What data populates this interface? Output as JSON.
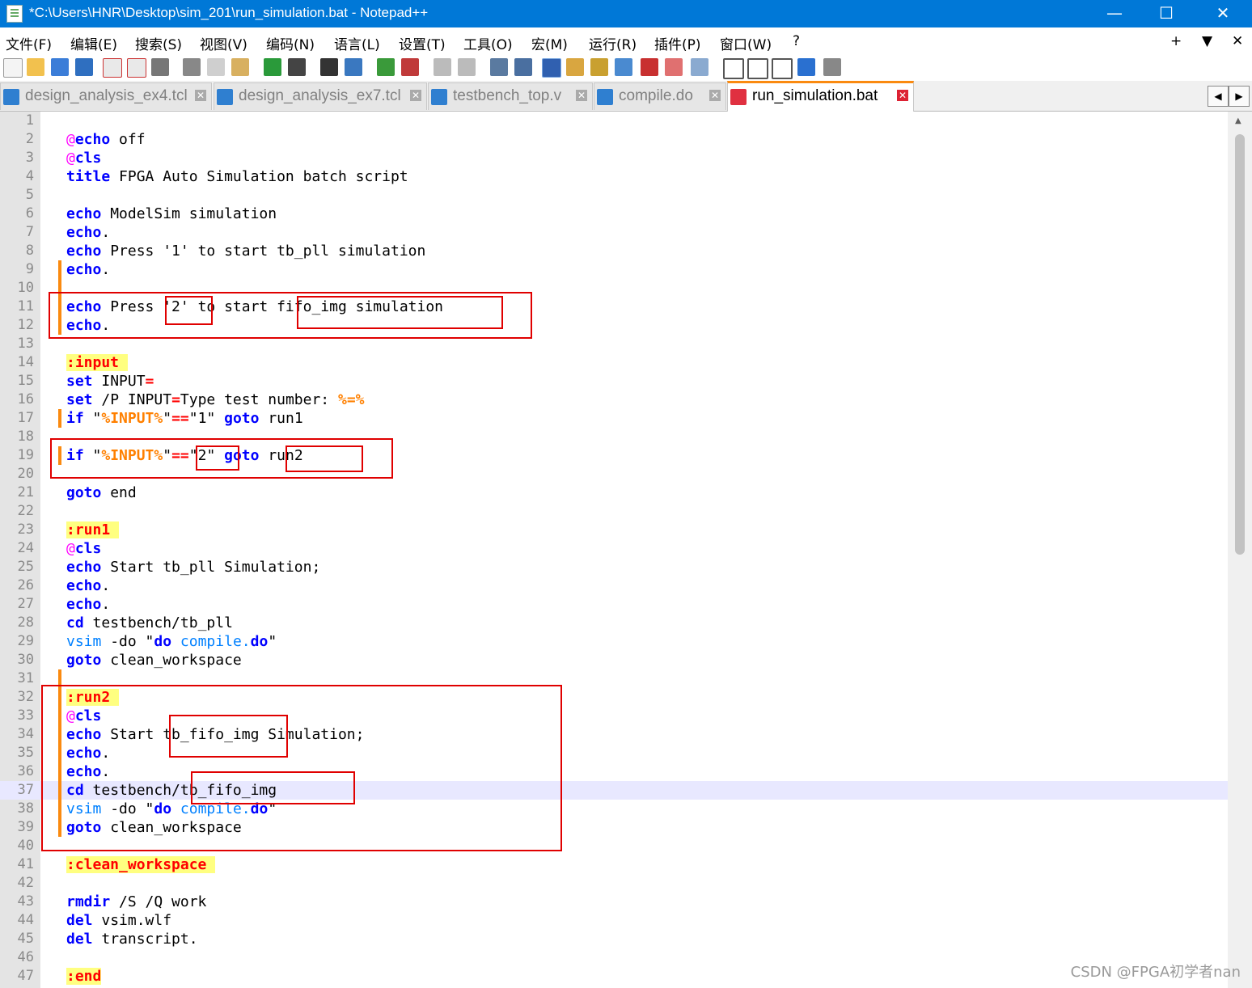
{
  "window": {
    "title": "*C:\\Users\\HNR\\Desktop\\sim_201\\run_simulation.bat - Notepad++",
    "minimize": "—",
    "maximize": "☐",
    "close": "✕"
  },
  "menu": {
    "items": [
      "文件(F)",
      "编辑(E)",
      "搜索(S)",
      "视图(V)",
      "编码(N)",
      "语言(L)",
      "设置(T)",
      "工具(O)",
      "宏(M)",
      "运行(R)",
      "插件(P)",
      "窗口(W)",
      "?"
    ],
    "right_plus": "+",
    "right_down": "▼",
    "right_close": "✕"
  },
  "tabs": [
    {
      "label": "design_analysis_ex4.tcl",
      "active": false
    },
    {
      "label": "design_analysis_ex7.tcl",
      "active": false
    },
    {
      "label": "testbench_top.v",
      "active": false
    },
    {
      "label": "compile.do",
      "active": false
    },
    {
      "label": "run_simulation.bat",
      "active": true
    }
  ],
  "tab_nav": {
    "left": "◀",
    "right": "▶"
  },
  "line_numbers": [
    "1",
    "2",
    "3",
    "4",
    "5",
    "6",
    "7",
    "8",
    "9",
    "10",
    "11",
    "12",
    "13",
    "14",
    "15",
    "16",
    "17",
    "18",
    "19",
    "20",
    "21",
    "22",
    "23",
    "24",
    "25",
    "26",
    "27",
    "28",
    "29",
    "30",
    "31",
    "32",
    "33",
    "34",
    "35",
    "36",
    "37",
    "38",
    "39",
    "40",
    "41",
    "42",
    "43",
    "44",
    "45",
    "46",
    "47"
  ],
  "code_lines": [
    [],
    [
      [
        "at",
        "@"
      ],
      [
        "kw",
        "echo"
      ],
      [
        "t",
        " off"
      ]
    ],
    [
      [
        "at",
        "@"
      ],
      [
        "kw",
        "cls"
      ]
    ],
    [
      [
        "kw",
        "title"
      ],
      [
        "t",
        " FPGA Auto Simulation batch script"
      ]
    ],
    [],
    [
      [
        "kw",
        "echo"
      ],
      [
        "t",
        " ModelSim simulation"
      ]
    ],
    [
      [
        "kw",
        "echo"
      ],
      [
        "t",
        "."
      ]
    ],
    [
      [
        "kw",
        "echo"
      ],
      [
        "t",
        " Press '1' to start tb_pll simulation"
      ]
    ],
    [
      [
        "kw",
        "echo"
      ],
      [
        "t",
        "."
      ]
    ],
    [],
    [
      [
        "kw",
        "echo"
      ],
      [
        "t",
        " Press '2' to start fifo_img simulation"
      ]
    ],
    [
      [
        "kw",
        "echo"
      ],
      [
        "t",
        "."
      ]
    ],
    [],
    [
      [
        "lbl",
        ":input "
      ]
    ],
    [
      [
        "kw",
        "set"
      ],
      [
        "t",
        " INPUT"
      ],
      [
        "op",
        "="
      ]
    ],
    [
      [
        "kw",
        "set"
      ],
      [
        "t",
        " /P INPUT"
      ],
      [
        "op",
        "="
      ],
      [
        "t",
        "Type test number: "
      ],
      [
        "var",
        "%=%"
      ]
    ],
    [
      [
        "kw",
        "if"
      ],
      [
        "t",
        " \""
      ],
      [
        "var",
        "%INPUT%"
      ],
      [
        "t",
        "\""
      ],
      [
        "op",
        "=="
      ],
      [
        "t",
        "\"1\" "
      ],
      [
        "kw",
        "goto"
      ],
      [
        "t",
        " run1"
      ]
    ],
    [],
    [
      [
        "kw",
        "if"
      ],
      [
        "t",
        " \""
      ],
      [
        "var",
        "%INPUT%"
      ],
      [
        "t",
        "\""
      ],
      [
        "op",
        "=="
      ],
      [
        "t",
        "\"2\" "
      ],
      [
        "kw",
        "goto"
      ],
      [
        "t",
        " run2"
      ]
    ],
    [],
    [
      [
        "kw",
        "goto"
      ],
      [
        "t",
        " end"
      ]
    ],
    [],
    [
      [
        "lbl",
        ":run1 "
      ]
    ],
    [
      [
        "at",
        "@"
      ],
      [
        "kw",
        "cls"
      ]
    ],
    [
      [
        "kw",
        "echo"
      ],
      [
        "t",
        " Start tb_pll Simulation;"
      ]
    ],
    [
      [
        "kw",
        "echo"
      ],
      [
        "t",
        "."
      ]
    ],
    [
      [
        "kw",
        "echo"
      ],
      [
        "t",
        "."
      ]
    ],
    [
      [
        "kw",
        "cd"
      ],
      [
        "t",
        " testbench/tb_pll"
      ]
    ],
    [
      [
        "ext",
        "vsim"
      ],
      [
        "t",
        " -do \""
      ],
      [
        "kw",
        "do"
      ],
      [
        "t",
        " "
      ],
      [
        "ext",
        "compile."
      ],
      [
        "kw",
        "do"
      ],
      [
        "t",
        "\""
      ]
    ],
    [
      [
        "kw",
        "goto"
      ],
      [
        "t",
        " clean_workspace"
      ]
    ],
    [],
    [
      [
        "lbl",
        ":run2 "
      ]
    ],
    [
      [
        "at",
        "@"
      ],
      [
        "kw",
        "cls"
      ]
    ],
    [
      [
        "kw",
        "echo"
      ],
      [
        "t",
        " Start tb_fifo_img Simulation;"
      ]
    ],
    [
      [
        "kw",
        "echo"
      ],
      [
        "t",
        "."
      ]
    ],
    [
      [
        "kw",
        "echo"
      ],
      [
        "t",
        "."
      ]
    ],
    [
      [
        "kw",
        "cd"
      ],
      [
        "t",
        " testbench/tb_fifo_img"
      ]
    ],
    [
      [
        "ext",
        "vsim"
      ],
      [
        "t",
        " -do \""
      ],
      [
        "kw",
        "do"
      ],
      [
        "t",
        " "
      ],
      [
        "ext",
        "compile."
      ],
      [
        "kw",
        "do"
      ],
      [
        "t",
        "\""
      ]
    ],
    [
      [
        "kw",
        "goto"
      ],
      [
        "t",
        " clean_workspace"
      ]
    ],
    [],
    [
      [
        "lbl",
        ":clean_workspace "
      ]
    ],
    [],
    [
      [
        "kw",
        "rmdir"
      ],
      [
        "t",
        " /S /Q work"
      ]
    ],
    [
      [
        "kw",
        "del"
      ],
      [
        "t",
        " vsim.wlf"
      ]
    ],
    [
      [
        "kw",
        "del"
      ],
      [
        "t",
        " transcript."
      ]
    ],
    [],
    [
      [
        "lbl",
        ":end"
      ]
    ]
  ],
  "current_line": 37,
  "colors": {
    "keyword": "#0000ff",
    "at": "#ff00ff",
    "label": "#ff0000",
    "label_bg": "#ffff80",
    "variable": "#ff8000",
    "annotation_box": "#e00000",
    "change_bar": "#fa8a10"
  },
  "watermark": "CSDN @FPGA初学者nan"
}
